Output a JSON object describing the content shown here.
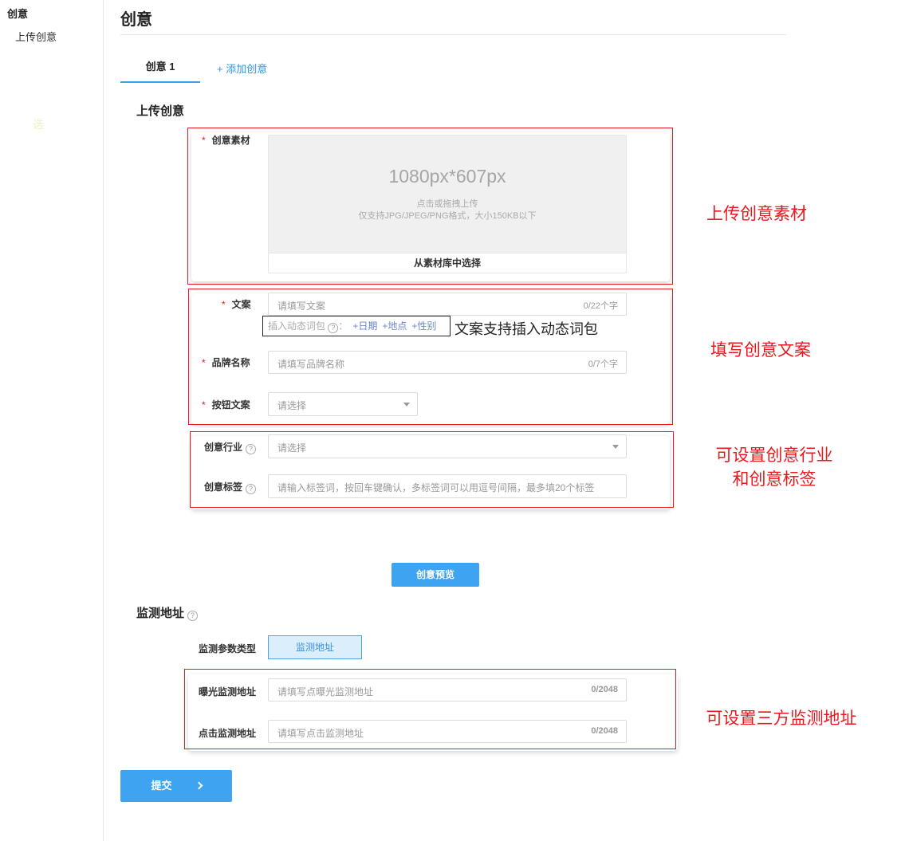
{
  "sidebar": {
    "heading": "创意",
    "item": "上传创意",
    "mark": "选"
  },
  "page": {
    "title": "创意"
  },
  "tabs": {
    "active": "创意 1",
    "add": "+ 添加创意"
  },
  "upload_section": {
    "title": "上传创意",
    "material_label": "创意素材",
    "size_text": "1080px*607px",
    "hint_line1": "点击或拖拽上传",
    "hint_line2": "仅支持JPG/JPEG/PNG格式，大小150KB以下",
    "library_button": "从素材库中选择"
  },
  "copy": {
    "label": "文案",
    "placeholder": "请填写文案",
    "counter": "0/22个字",
    "dynamic_label": "插入动态词包 ",
    "dynamic_help": "?",
    "dynamic_colon": "：",
    "chips": [
      "+日期",
      "+地点",
      "+性别"
    ],
    "dynamic_note": "文案支持插入动态词包"
  },
  "brand": {
    "label": "品牌名称",
    "placeholder": "请填写品牌名称",
    "counter": "0/7个字"
  },
  "button_copy": {
    "label": "按钮文案",
    "placeholder": "请选择"
  },
  "industry": {
    "label": "创意行业",
    "placeholder": "请选择"
  },
  "tags": {
    "label": "创意标签",
    "placeholder": "请输入标签词，按回车键确认，多标签词可以用逗号间隔，最多填20个标签"
  },
  "preview_button": "创意预览",
  "monitor": {
    "title": "监测地址",
    "type_label": "监测参数类型",
    "type_button": "监测地址",
    "impression_label": "曝光监测地址",
    "impression_placeholder": "请填写点曝光监测地址",
    "impression_counter": "0/2048",
    "click_label": "点击监测地址",
    "click_placeholder": "请填写点击监测地址",
    "click_counter": "0/2048"
  },
  "submit_button": "提交",
  "annotations": {
    "upload": "上传创意素材",
    "copy": "填写创意文案",
    "industry_line1": "可设置创意行业",
    "industry_line2": "和创意标签",
    "monitor": "可设置三方监测地址"
  },
  "colors": {
    "accent": "#3ea3f1",
    "annotation_red": "#e8191e",
    "chip_blue": "#6b86c9"
  },
  "icons": {
    "help": "question-circle-icon",
    "dropdown": "caret-down-icon",
    "submit": "chevron-right-icon"
  }
}
